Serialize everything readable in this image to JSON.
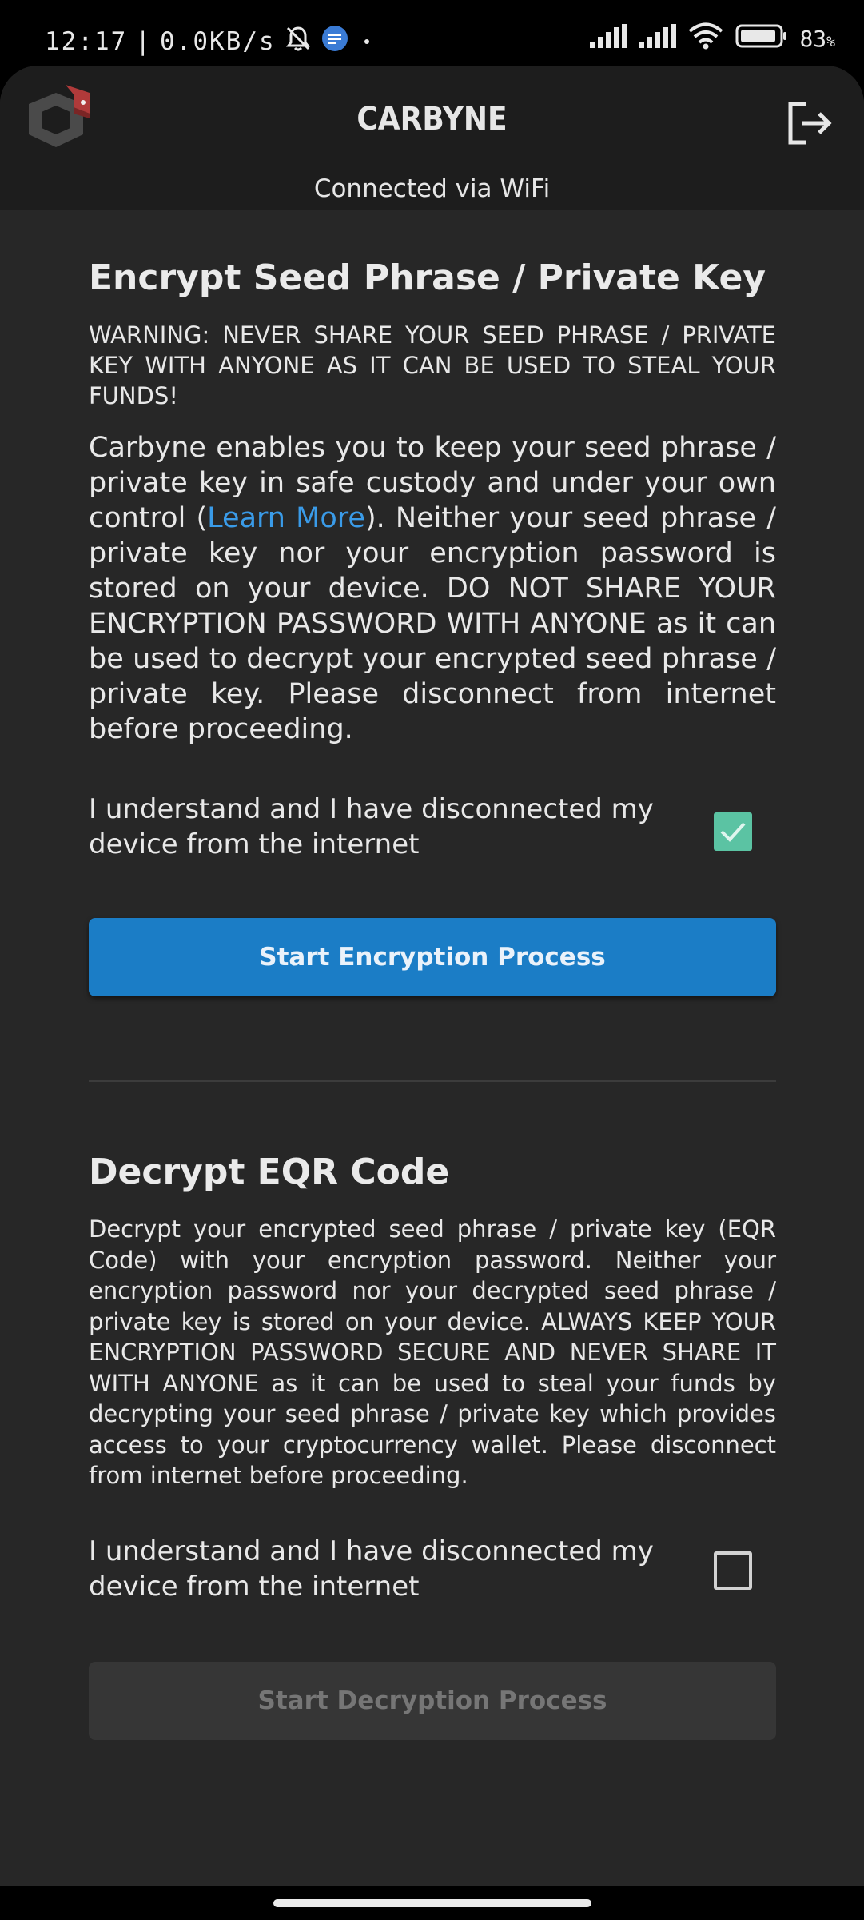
{
  "status_bar": {
    "time": "12:17",
    "separator": "|",
    "net_speed": "0.0KB/s",
    "battery": "83",
    "battery_unit": "%",
    "icons": [
      "mute-notifications-icon",
      "messages-icon",
      "dot-icon",
      "signal-icon",
      "signal-icon",
      "wifi-icon",
      "battery-icon"
    ]
  },
  "app_bar": {
    "title": "CARBYNE",
    "connection_status": "Connected via WiFi",
    "logo_icon": "carbyne-logo-icon",
    "logout_icon": "logout-icon"
  },
  "encrypt": {
    "title": "Encrypt Seed Phrase / Private Key",
    "warning": "WARNING: NEVER SHARE YOUR SEED PHRASE / PRIVATE KEY WITH ANYONE AS IT CAN BE USED TO STEAL YOUR FUNDS!",
    "body_before_link": "Carbyne enables you to keep your seed phrase / private key in safe custody and under your own control (",
    "link_text": "Learn More",
    "body_after_link": "). Neither your seed phrase / private key nor your encryption password is stored on your device. DO NOT SHARE YOUR ENCRYPTION PASSWORD WITH ANYONE as it can be used to decrypt your encrypted seed phrase / private key. Please disconnect from internet before proceeding.",
    "confirm_label": "I understand and I have disconnected my device from the internet",
    "confirm_checked": true,
    "button_label": "Start Encryption Process"
  },
  "decrypt": {
    "title": "Decrypt EQR Code",
    "body": "Decrypt your encrypted seed phrase / private key (EQR Code) with your encryption password. Neither your encryption password nor your decrypted seed phrase / private key is stored on your device. ALWAYS KEEP YOUR ENCRYPTION PASSWORD SECURE AND NEVER SHARE IT WITH ANYONE as it can be used to steal your funds by decrypting your seed phrase / private key which provides access to your cryptocurrency wallet. Please disconnect from internet before proceeding.",
    "confirm_label": "I understand and I have disconnected my device from the internet",
    "confirm_checked": false,
    "button_label": "Start Decryption Process"
  },
  "colors": {
    "primary_button": "#1b7dc6",
    "checkbox_checked": "#5bc3a3",
    "link": "#3a9be8",
    "background": "#272727",
    "app_bar": "#1d1d1d"
  }
}
